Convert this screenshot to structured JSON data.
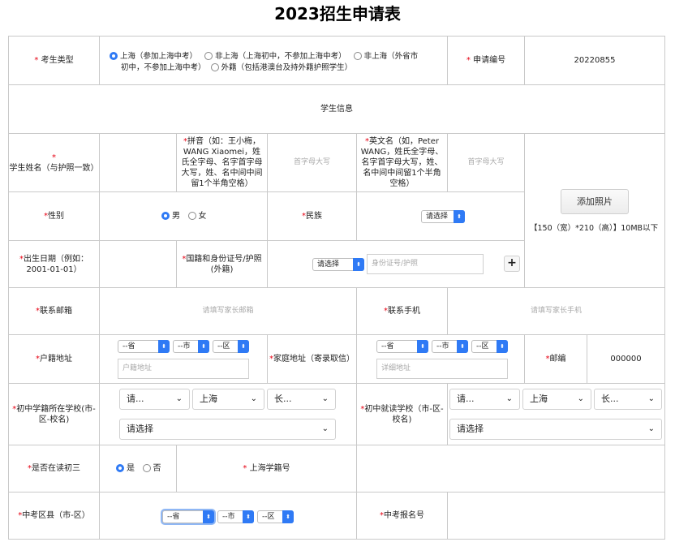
{
  "page_title": "2023招生申请表",
  "required_mark": "*",
  "row1": {
    "candidate_type_label": "考生类型",
    "options": [
      "上海（参加上海中考）",
      "非上海（上海初中，不参加上海中考）",
      "非上海（外省市初中，不参加上海中考）",
      "外籍（包括港澳台及持外籍护照学生）"
    ],
    "option3_line1": "非上海（外省市",
    "option3_line2": "初中，不参加上海中考）",
    "selected_index": 0,
    "app_no_label": "申请编号",
    "app_no_value": "20220855"
  },
  "section_title": "学生信息",
  "name_row": {
    "name_label": "学生姓名（与护照一致）",
    "pinyin_label": "拼音（如：王小梅，WANG Xiaomei，姓氏全字母、名字首字母大写，姓、名中间中间留1个半角空格）",
    "pinyin_placeholder": "首字母大写",
    "english_label": "英文名（如，Peter WANG，姓氏全字母、名字首字母大写，姓、名中间中间留1个半角空格）",
    "english_placeholder": "首字母大写"
  },
  "photo": {
    "button": "添加照片",
    "hint": "【150（宽）*210（高）】10MB以下"
  },
  "gender_row": {
    "label": "性别",
    "male": "男",
    "female": "女",
    "selected": "男",
    "ethnicity_label": "民族",
    "ethnicity_select": "请选择"
  },
  "birth_row": {
    "birth_label": "出生日期（例如：2001-01-01）",
    "nationality_label": "国籍和身份证号/护照(外籍)",
    "nationality_select": "请选择",
    "id_placeholder": "身份证号/护照",
    "add_button": "+"
  },
  "contact_row": {
    "email_label": "联系邮箱",
    "email_placeholder": "请填写家长邮箱",
    "phone_label": "联系手机",
    "phone_placeholder": "请填写家长手机"
  },
  "address_row": {
    "hukou_label": "户籍地址",
    "province": "--省",
    "city": "--市",
    "district": "--区",
    "hukou_placeholder": "户籍地址",
    "home_label": "家庭地址（寄录取信）",
    "home_placeholder": "详细地址",
    "postcode_label": "邮编",
    "postcode_value": "000000"
  },
  "school_row": {
    "reg_school_label": "初中学籍所在学校(市-区-校名)",
    "attend_school_label": "初中就读学校（市-区-校名)",
    "sel_a": "请...",
    "sel_b": "上海",
    "sel_c": "长...",
    "sel_school": "请选择"
  },
  "grade_row": {
    "label": "是否在读初三",
    "yes": "是",
    "no": "否",
    "selected": "是",
    "sh_reg_label": "上海学籍号"
  },
  "exam_row": {
    "district_label": "中考区县（市-区）",
    "province": "--省",
    "city": "--市",
    "district": "--区",
    "exam_no_label": "中考报名号"
  },
  "colors": {
    "accent": "#2f7af5",
    "required": "#e60012",
    "border": "#c9c9c9"
  }
}
